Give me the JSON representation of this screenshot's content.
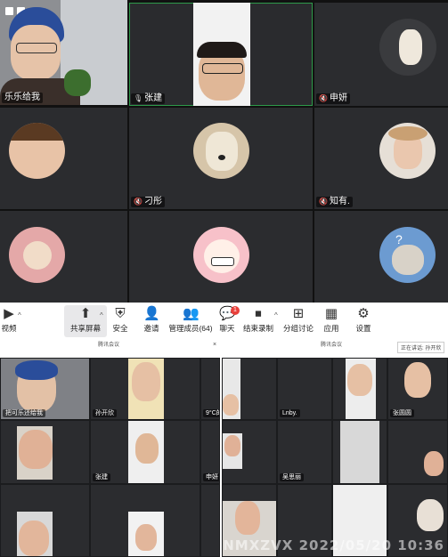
{
  "participants_top": [
    {
      "name": "乐乐给我",
      "type": "video"
    },
    {
      "name": "张建",
      "type": "video"
    },
    {
      "name": "申妍",
      "type": "avatar"
    },
    {
      "name": "",
      "type": "avatar"
    },
    {
      "name": "刁彤",
      "type": "avatar"
    },
    {
      "name": "知有.",
      "type": "avatar"
    },
    {
      "name": "",
      "type": "avatar"
    },
    {
      "name": "",
      "type": "avatar"
    },
    {
      "name": "",
      "type": "avatar"
    }
  ],
  "toolbar": {
    "video_label": "视频",
    "share_label": "共享屏幕",
    "security_label": "安全",
    "invite_label": "邀请",
    "manage_label": "管理成员(64)",
    "chat_label": "聊天",
    "chat_badge": "1",
    "record_label": "结束录制",
    "breakout_label": "分组讨论",
    "apps_label": "应用",
    "settings_label": "设置"
  },
  "lower": {
    "left_title": "腾讯会议",
    "right_title": "腾讯会议",
    "share_notice": "正在讲话: 孙开欣",
    "left_tiles": [
      "把可乐还给我",
      "孙开欣",
      "9°C的",
      "",
      "张建",
      "申妍",
      "",
      "",
      ""
    ],
    "right_tiles": [
      "",
      "Lnby.",
      "",
      "张圆圆",
      "",
      "吴思丽",
      "",
      "",
      ""
    ],
    "watermark": "NMXZVX 2022/05/20 10:36"
  }
}
